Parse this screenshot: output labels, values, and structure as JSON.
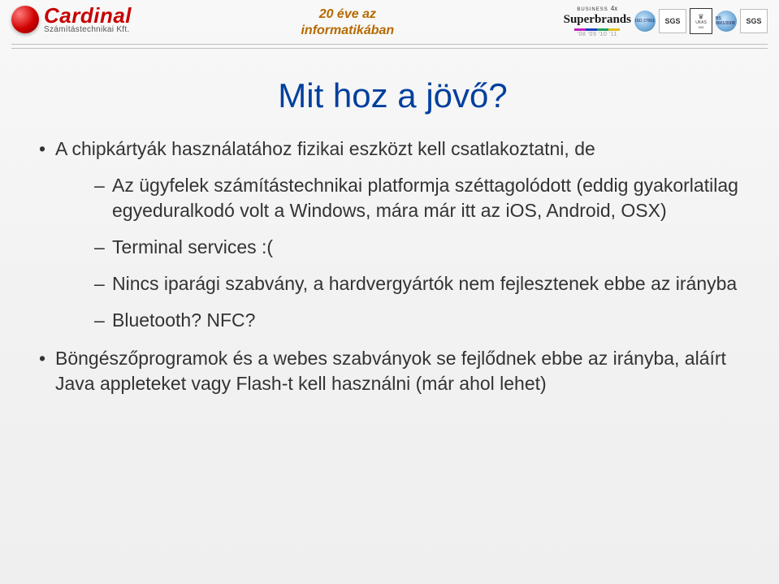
{
  "header": {
    "logo_main": "Cardinal",
    "logo_sub": "Számítástechnikai Kft.",
    "tagline_line1": "20 éve az",
    "tagline_line2": "informatikában",
    "badges": {
      "superbrands_top": "BUSINESS",
      "superbrands_prefix": "4x",
      "superbrands_main": "Superbrands",
      "superbrands_years": "'08 '09 '10 '11",
      "iso_label": "ISO 27001",
      "sgs_label": "SGS",
      "ukas_label": "UKAS",
      "bs_label": "BS 9001/2008"
    }
  },
  "slide": {
    "title": "Mit hoz a jövő?",
    "bullets": [
      {
        "text": "A chipkártyák használatához fizikai eszközt kell csatlakoztatni, de",
        "children": [
          "Az ügyfelek számítástechnikai platformja széttagolódott (eddig gyakorlatilag egyeduralkodó volt a Windows, mára már itt az iOS, Android, OSX)",
          "Terminal services :(",
          "Nincs iparági szabvány, a hardvergyártók nem fejlesztenek ebbe az irányba",
          "Bluetooth? NFC?"
        ]
      },
      {
        "text": "Böngészőprogramok és a webes szabványok se fejlődnek ebbe az irányba, aláírt Java appleteket vagy Flash-t kell használni (már ahol lehet)"
      }
    ]
  }
}
